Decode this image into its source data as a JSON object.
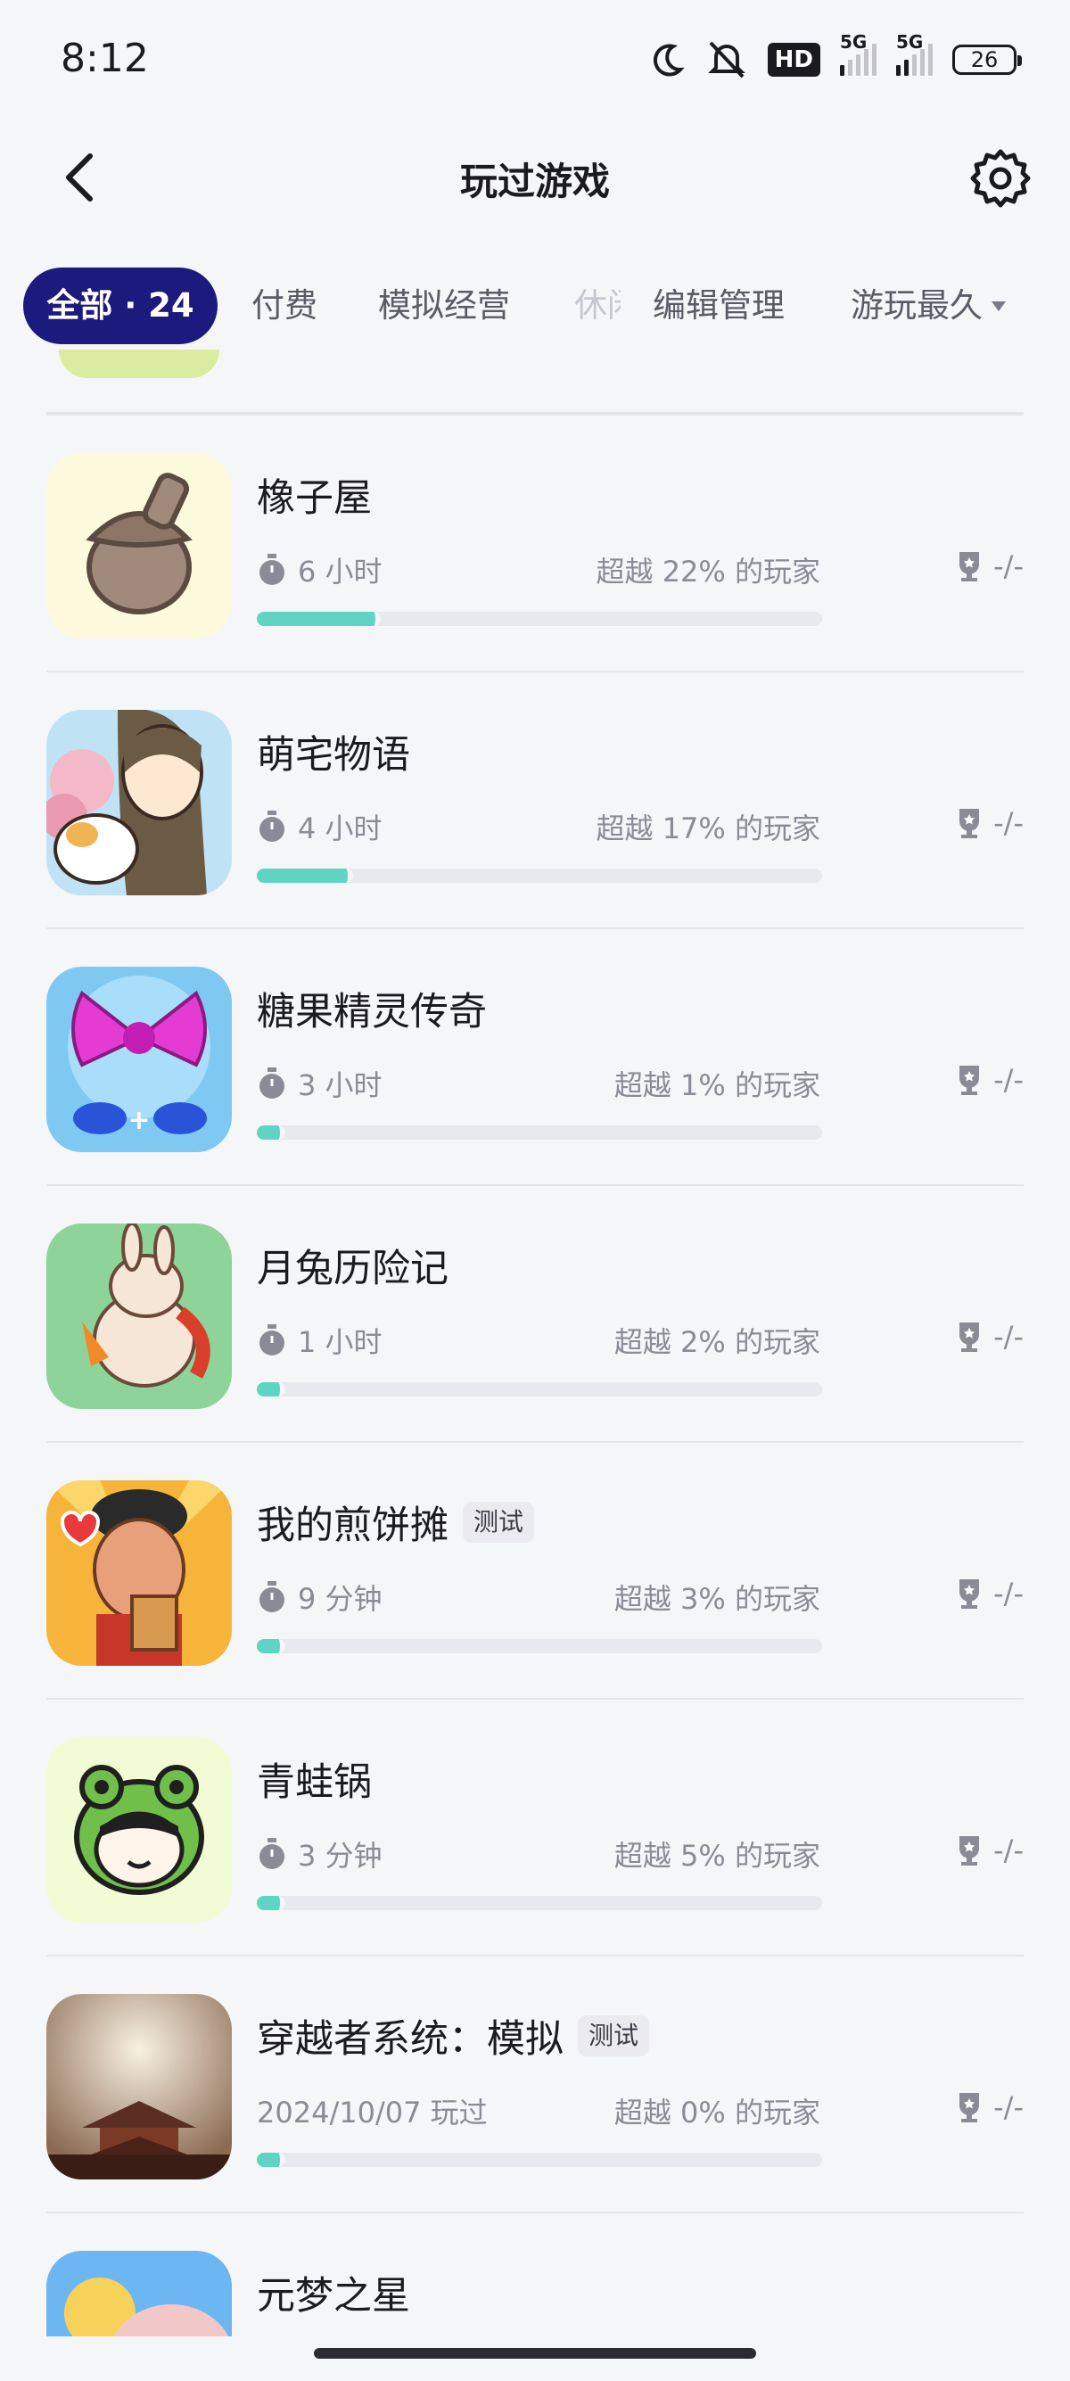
{
  "status_bar": {
    "time": "8:12",
    "hd_label": "HD",
    "sim1_label": "5G",
    "sim2_label": "5G",
    "battery_level": "26"
  },
  "header": {
    "title": "玩过游戏",
    "back_icon": "chevron-left-icon",
    "settings_icon": "gear-icon"
  },
  "filter_tabs": {
    "all": "全部 · 24",
    "paid": "付费",
    "sim_biz": "模拟经营",
    "casual_partial": "休闲",
    "edit": "编辑管理",
    "sort": "游玩最久"
  },
  "accent_colors": {
    "active_tab": "#1c1a7d",
    "progress": "#5fd4c3",
    "track": "#e8e9ec"
  },
  "games": [
    {
      "name": "橡子屋",
      "tag": "",
      "time": "6 小时",
      "exceed": "超越 22% 的玩家",
      "progress": 0.22,
      "trophy": "-/-"
    },
    {
      "name": "萌宅物语",
      "tag": "",
      "time": "4 小时",
      "exceed": "超越 17% 的玩家",
      "progress": 0.17,
      "trophy": "-/-"
    },
    {
      "name": "糖果精灵传奇",
      "tag": "",
      "time": "3 小时",
      "exceed": "超越 1% 的玩家",
      "progress": 0.05,
      "trophy": "-/-"
    },
    {
      "name": "月兔历险记",
      "tag": "",
      "time": "1 小时",
      "exceed": "超越 2% 的玩家",
      "progress": 0.05,
      "trophy": "-/-"
    },
    {
      "name": "我的煎饼摊",
      "tag": "测试",
      "time": "9 分钟",
      "exceed": "超越 3% 的玩家",
      "progress": 0.05,
      "trophy": "-/-"
    },
    {
      "name": "青蛙锅",
      "tag": "",
      "time": "3 分钟",
      "exceed": "超越 5% 的玩家",
      "progress": 0.05,
      "trophy": "-/-"
    },
    {
      "name": "穿越者系统：模拟",
      "tag": "测试",
      "time": "2024/10/07 玩过",
      "exceed": "超越 0% 的玩家",
      "progress": 0.05,
      "trophy": "-/-"
    },
    {
      "name": "元梦之星",
      "tag": "",
      "time": "",
      "exceed": "",
      "progress": 0,
      "trophy": ""
    }
  ]
}
